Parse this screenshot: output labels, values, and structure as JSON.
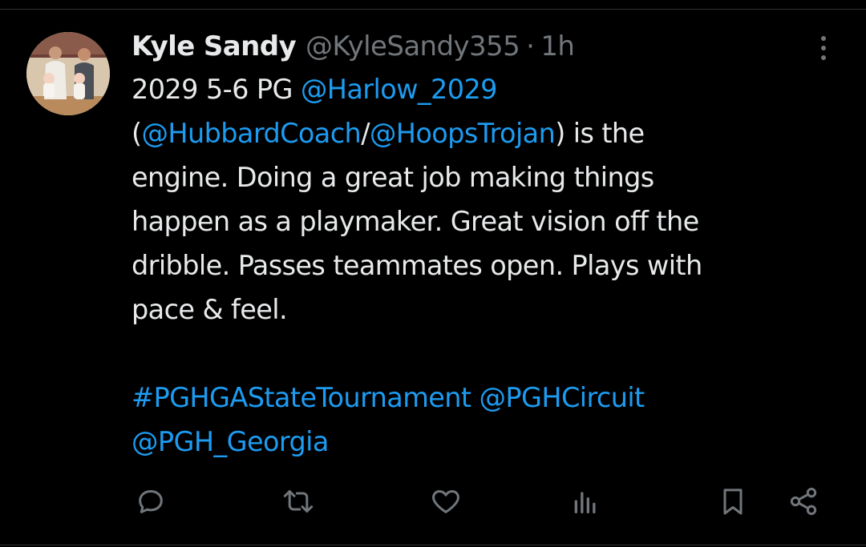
{
  "tweet": {
    "author": {
      "display_name": "Kyle Sandy",
      "handle": "@KyleSandy355",
      "separator": "·",
      "time": "1h"
    },
    "lines": [
      [
        {
          "text": "2029 5-6 PG ",
          "link": false
        },
        {
          "text": "@Harlow_2029",
          "link": true
        }
      ],
      [
        {
          "text": "(",
          "link": false
        },
        {
          "text": "@HubbardCoach",
          "link": true
        },
        {
          "text": "/",
          "link": false
        },
        {
          "text": "@HoopsTrojan",
          "link": true
        },
        {
          "text": ") is the",
          "link": false
        }
      ],
      [
        {
          "text": "engine. Doing a great job making things",
          "link": false
        }
      ],
      [
        {
          "text": "happen as a playmaker. Great vision off the",
          "link": false
        }
      ],
      [
        {
          "text": "dribble. Passes teammates open. Plays with",
          "link": false
        }
      ],
      [
        {
          "text": "pace & feel.",
          "link": false
        }
      ],
      [],
      [
        {
          "text": "#PGHGAStateTournament",
          "link": true
        },
        {
          "text": " ",
          "link": false
        },
        {
          "text": "@PGHCircuit",
          "link": true
        }
      ],
      [
        {
          "text": "@PGH_Georgia",
          "link": true
        }
      ]
    ]
  },
  "icons": {
    "more": "more-vertical-icon",
    "reply": "reply-icon",
    "retweet": "retweet-icon",
    "like": "heart-icon",
    "views": "views-icon",
    "bookmark": "bookmark-icon",
    "share": "share-icon"
  },
  "colors": {
    "background": "#000000",
    "text": "#e7e9ea",
    "muted": "#71767b",
    "link": "#1d9bf0",
    "divider": "#2f3336"
  }
}
